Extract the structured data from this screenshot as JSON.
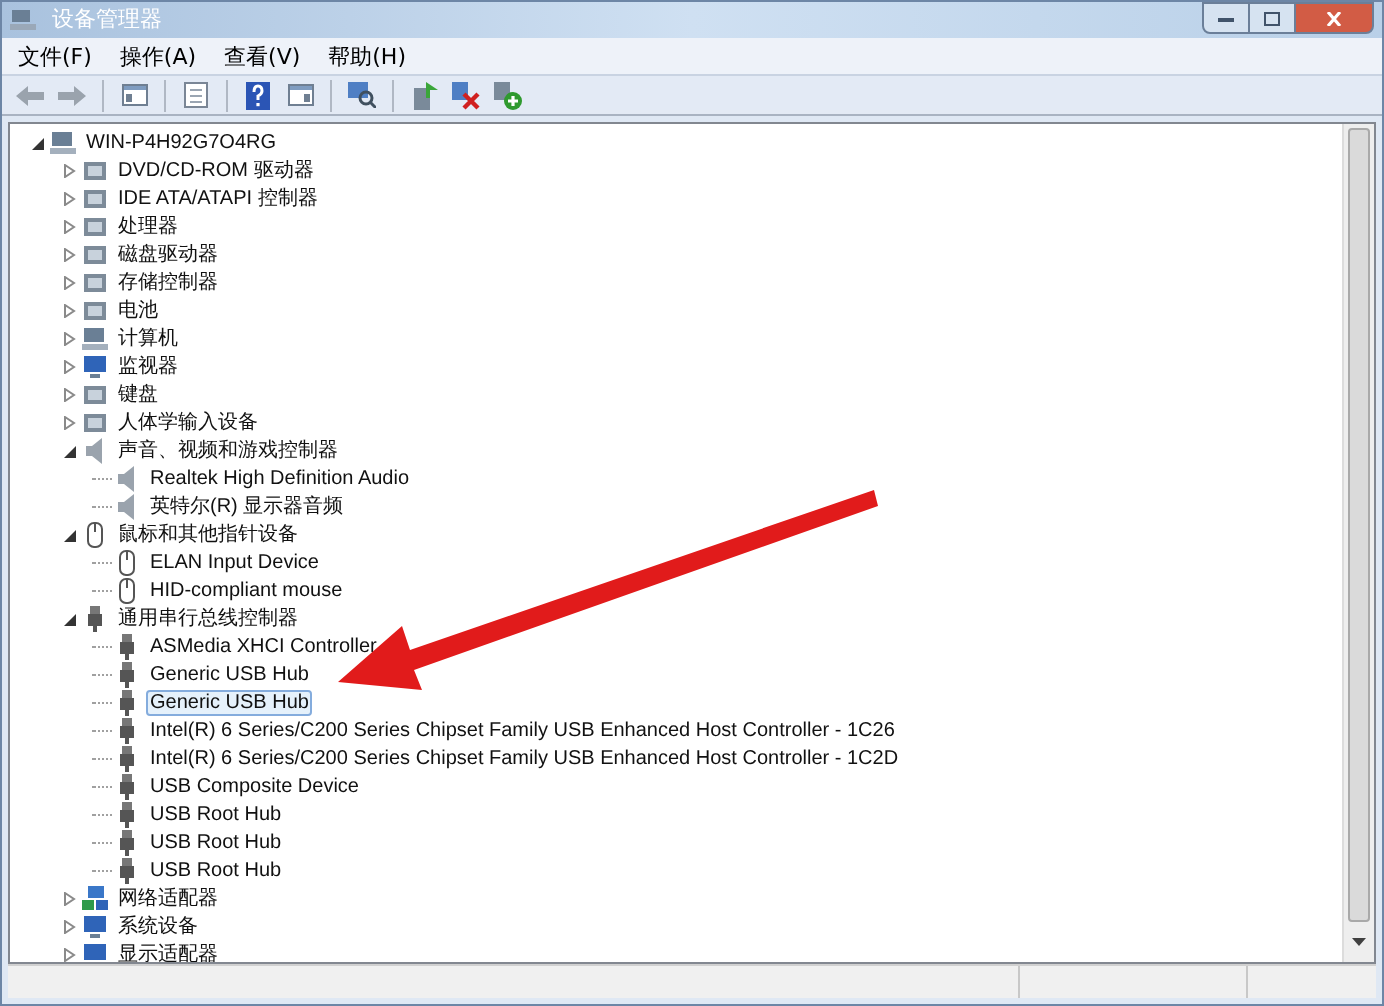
{
  "window": {
    "title": "设备管理器"
  },
  "menu": [
    "文件(F)",
    "操作(A)",
    "查看(V)",
    "帮助(H)"
  ],
  "tree": {
    "label": "WIN-P4H92G7O4RG",
    "expanded": true,
    "children": [
      {
        "label": "DVD/CD-ROM 驱动器",
        "expanded": false,
        "selected": false
      },
      {
        "label": "IDE ATA/ATAPI 控制器",
        "expanded": false,
        "selected": false
      },
      {
        "label": "处理器",
        "expanded": false,
        "selected": false
      },
      {
        "label": "磁盘驱动器",
        "expanded": false,
        "selected": false
      },
      {
        "label": "存储控制器",
        "expanded": false,
        "selected": false
      },
      {
        "label": "电池",
        "expanded": false,
        "selected": false
      },
      {
        "label": "计算机",
        "expanded": false,
        "selected": false
      },
      {
        "label": "监视器",
        "expanded": false,
        "selected": false
      },
      {
        "label": "键盘",
        "expanded": false,
        "selected": false
      },
      {
        "label": "人体学输入设备",
        "expanded": false,
        "selected": false
      },
      {
        "label": "声音、视频和游戏控制器",
        "expanded": true,
        "selected": false,
        "children": [
          {
            "label": "Realtek High Definition Audio",
            "selected": false
          },
          {
            "label": "英特尔(R) 显示器音频",
            "selected": false
          }
        ]
      },
      {
        "label": "鼠标和其他指针设备",
        "expanded": true,
        "selected": false,
        "children": [
          {
            "label": "ELAN Input Device",
            "selected": false
          },
          {
            "label": "HID-compliant mouse",
            "selected": false
          }
        ]
      },
      {
        "label": "通用串行总线控制器",
        "expanded": true,
        "selected": false,
        "children": [
          {
            "label": "ASMedia XHCI Controller",
            "selected": false
          },
          {
            "label": "Generic USB Hub",
            "selected": false
          },
          {
            "label": "Generic USB Hub",
            "selected": true
          },
          {
            "label": "Intel(R) 6 Series/C200 Series Chipset Family USB Enhanced Host Controller - 1C26",
            "selected": false
          },
          {
            "label": "Intel(R) 6 Series/C200 Series Chipset Family USB Enhanced Host Controller - 1C2D",
            "selected": false
          },
          {
            "label": "USB Composite Device",
            "selected": false
          },
          {
            "label": "USB Root Hub",
            "selected": false
          },
          {
            "label": "USB Root Hub",
            "selected": false
          },
          {
            "label": "USB Root Hub",
            "selected": false
          }
        ]
      },
      {
        "label": "网络适配器",
        "expanded": false,
        "selected": false
      },
      {
        "label": "系统设备",
        "expanded": false,
        "selected": false
      },
      {
        "label": "显示适配器",
        "expanded": false,
        "selected": false
      }
    ]
  }
}
